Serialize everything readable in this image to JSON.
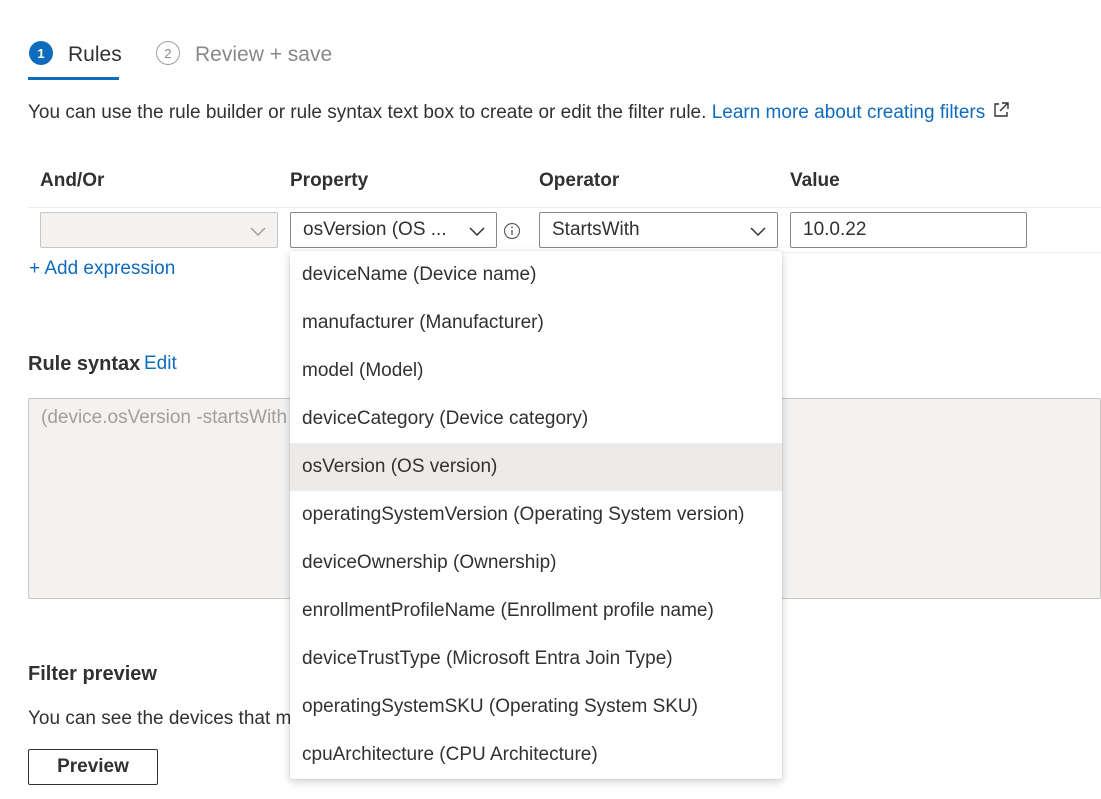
{
  "steps": [
    {
      "number": "1",
      "label": "Rules"
    },
    {
      "number": "2",
      "label": "Review + save"
    }
  ],
  "description": {
    "text": "You can use the rule builder or rule syntax text box to create or edit the filter rule.",
    "link": "Learn more about creating filters"
  },
  "columns": {
    "and_or": "And/Or",
    "property": "Property",
    "operator": "Operator",
    "value": "Value"
  },
  "row": {
    "and_or_value": "",
    "property_value": "osVersion (OS ...",
    "operator_value": "StartsWith",
    "value": "10.0.22"
  },
  "add_expression": "+ Add expression",
  "rule_syntax": {
    "title": "Rule syntax",
    "edit_link": "Edit",
    "text": "(device.osVersion -startsWith"
  },
  "filter_preview": {
    "title": "Filter preview",
    "text": "You can see the devices that m",
    "button": "Preview"
  },
  "dropdown": {
    "selected": "osVersion (OS version)",
    "options": [
      "deviceName (Device name)",
      "manufacturer (Manufacturer)",
      "model (Model)",
      "deviceCategory (Device category)",
      "osVersion (OS version)",
      "operatingSystemVersion (Operating System version)",
      "deviceOwnership (Ownership)",
      "enrollmentProfileName (Enrollment profile name)",
      "deviceTrustType (Microsoft Entra Join Type)",
      "operatingSystemSKU (Operating System SKU)",
      "cpuArchitecture (CPU Architecture)"
    ]
  },
  "colors": {
    "accent": "#0f6cbd",
    "selected_option_bg": "#edebe9"
  }
}
